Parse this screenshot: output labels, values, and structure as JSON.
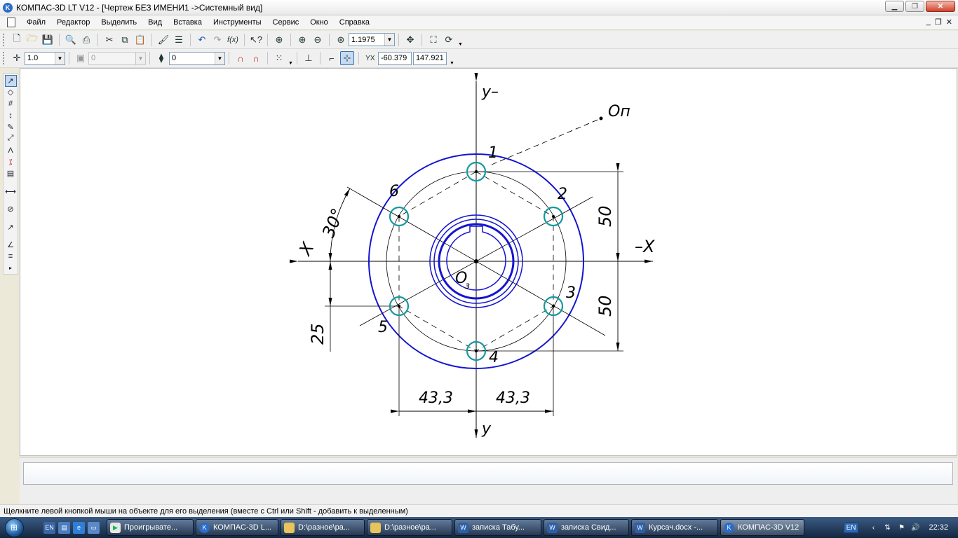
{
  "window": {
    "title": "КОМПАС-3D LT V12 - [Чертеж БЕЗ ИМЕНИ1 ->Системный вид]",
    "app_icon_letter": "K"
  },
  "menu": {
    "items": [
      "Файл",
      "Редактор",
      "Выделить",
      "Вид",
      "Вставка",
      "Инструменты",
      "Сервис",
      "Окно",
      "Справка"
    ]
  },
  "toolbar1": {
    "zoom_value": "1.1975"
  },
  "toolbar2": {
    "step_value": "1.0",
    "layer_disabled_value": "0",
    "style_value": "0",
    "coord_x": "-60.379",
    "coord_y": "147.921"
  },
  "drawing": {
    "labels": {
      "axis_y_top": "y–",
      "axis_x_right": "–X",
      "axis_x_left": "X",
      "axis_y_bottom": "y",
      "point_op": "Оп",
      "center": "О",
      "center_sub": "з",
      "angle": "30°",
      "dim_50_upper": "50",
      "dim_50_lower": "50",
      "dim_25": "25",
      "dim_43_left": "43,3",
      "dim_43_right": "43,3",
      "hole_1": "1",
      "hole_2": "2",
      "hole_3": "3",
      "hole_4": "4",
      "hole_5": "5",
      "hole_6": "6"
    },
    "colors": {
      "outline": "#1414d0",
      "holes": "#149aa0",
      "lines": "#000000"
    }
  },
  "status": {
    "hint": "Щелкните левой кнопкой мыши на объекте для его выделения (вместе с Ctrl или Shift - добавить к выделенным)"
  },
  "taskbar": {
    "start_label": "⊞",
    "tasks": [
      "Проигрывате...",
      "КОМПАС-3D L...",
      "D:\\разное\\ра...",
      "D:\\разное\\ра...",
      "записка Табу...",
      "записка Свид...",
      "Курсач.docx -...",
      "КОМПАС-3D V12"
    ],
    "lang": "EN",
    "clock": "22:32"
  }
}
